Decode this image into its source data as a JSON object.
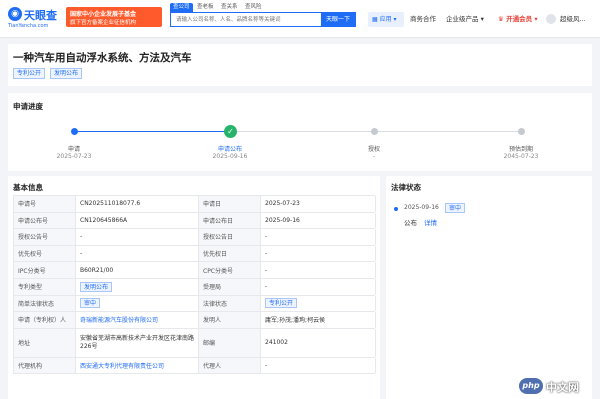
{
  "header": {
    "logo_name": "天眼查",
    "logo_domain": "TianYancha.com",
    "promo_line1": "国家中小企业发展子基金",
    "promo_line2": "旗下官方备案企业征信机构",
    "search_tabs": [
      "查公司",
      "查老板",
      "查关系",
      "查风险"
    ],
    "search_placeholder": "请输入公司名称、人名、品牌名称等关键词",
    "search_button": "天眼一下",
    "app_button": "应用",
    "nav_business": "商务合作",
    "nav_products": "企业级产品",
    "nav_vip": "开通会员",
    "nav_user": "超级风..."
  },
  "patent": {
    "title": "一种汽车用自动浮水系统、方法及汽车",
    "tags": [
      "专利公开",
      "发明公布"
    ]
  },
  "progress": {
    "section_title": "申请进度",
    "steps": [
      {
        "label": "申请",
        "date": "2025-07-23"
      },
      {
        "label": "申请公布",
        "date": "2025-09-16"
      },
      {
        "label": "授权",
        "date": "-"
      },
      {
        "label": "预估到期",
        "date": "2045-07-23"
      }
    ],
    "current_step": 1
  },
  "basic_info": {
    "section_title": "基本信息",
    "rows": [
      {
        "l1": "申请号",
        "v1": "CN202511018077.6",
        "l2": "申请日",
        "v2": "2025-07-23"
      },
      {
        "l1": "申请公布号",
        "v1": "CN120645866A",
        "l2": "申请公布日",
        "v2": "2025-09-16"
      },
      {
        "l1": "授权公告号",
        "v1": "-",
        "l2": "授权公告日",
        "v2": "-"
      },
      {
        "l1": "优先权号",
        "v1": "-",
        "l2": "优先权日",
        "v2": "-"
      },
      {
        "l1": "IPC分类号",
        "v1": "B60R21/00",
        "l2": "CPC分类号",
        "v2": "-"
      },
      {
        "l1": "专利类型",
        "v1": "发明公布",
        "l2": "受理局",
        "v2": "-"
      },
      {
        "l1": "简单法律状态",
        "v1": "审中",
        "l2": "法律状态",
        "v2": "专利公开"
      },
      {
        "l1": "申请（专利权）人",
        "v1": "奇瑞新能源汽车股份有限公司",
        "l2": "发明人",
        "v2": "庸军;孙茂;潘珣;柯云侯"
      },
      {
        "l1": "地址",
        "v1": "安徽省芜湖市高新技术产业开发区花津南路226号",
        "l2": "邮编",
        "v2": "241002"
      },
      {
        "l1": "代理机构",
        "v1": "西安通大专利代理有限责任公司",
        "l2": "代理人",
        "v2": "-"
      }
    ]
  },
  "legal_status": {
    "section_title": "法律状态",
    "events": [
      {
        "date": "2025-09-16",
        "status": "审中",
        "event": "公布",
        "detail": "详情"
      }
    ]
  },
  "watermark": {
    "logo": "php",
    "text": "中文网"
  }
}
